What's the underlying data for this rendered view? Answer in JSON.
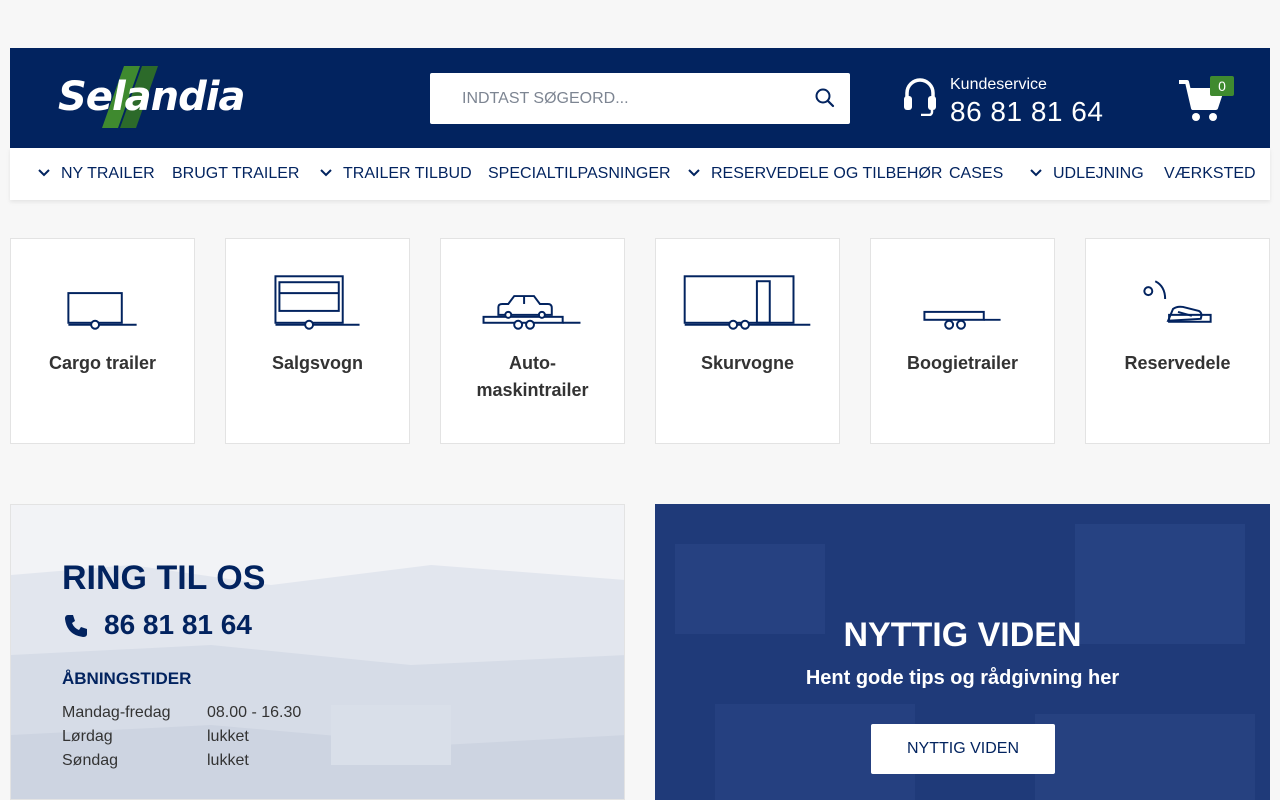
{
  "brand": {
    "name": "Selandia",
    "primary_color": "#02235f",
    "accent_green": "#3f8a2f"
  },
  "search": {
    "placeholder": "INDTAST SØGEORD...",
    "icon": "search-icon"
  },
  "customer_service": {
    "label": "Kundeservice",
    "phone": "86 81 81 64",
    "icon": "headset-icon"
  },
  "cart": {
    "count": "0",
    "icon": "cart-icon"
  },
  "nav": {
    "items": [
      {
        "label": "NY TRAILER",
        "has_dropdown": true
      },
      {
        "label": "BRUGT TRAILER",
        "has_dropdown": false
      },
      {
        "label": "TRAILER TILBUD",
        "has_dropdown": true
      },
      {
        "label": "SPECIALTILPASNINGER",
        "has_dropdown": false
      },
      {
        "label": "RESERVEDELE OG TILBEHØR",
        "has_dropdown": true
      },
      {
        "label": "CASES",
        "has_dropdown": false
      },
      {
        "label": "UDLEJNING",
        "has_dropdown": true
      },
      {
        "label": "VÆRKSTED",
        "has_dropdown": false
      }
    ]
  },
  "categories": [
    {
      "label": "Cargo trailer",
      "icon": "cargo-trailer-icon"
    },
    {
      "label": "Salgsvogn",
      "icon": "sales-wagon-icon"
    },
    {
      "label": "Auto-\nmaskintrailer",
      "icon": "car-trailer-icon"
    },
    {
      "label": "Skurvogne",
      "icon": "site-hut-trailer-icon"
    },
    {
      "label": "Boogietrailer",
      "icon": "boogie-trailer-icon"
    },
    {
      "label": "Reservedele",
      "icon": "spare-parts-icon"
    }
  ],
  "call": {
    "title": "RING TIL OS",
    "phone": "86 81 81 64",
    "hours_title": "ÅBNINGSTIDER",
    "hours": [
      {
        "day": "Mandag-fredag",
        "time": "08.00 - 16.30"
      },
      {
        "day": "Lørdag",
        "time": "lukket"
      },
      {
        "day": "Søndag",
        "time": "lukket"
      }
    ]
  },
  "viden": {
    "title": "NYTTIG VIDEN",
    "subtitle": "Hent gode tips og rådgivning her",
    "button": "NYTTIG VIDEN"
  }
}
